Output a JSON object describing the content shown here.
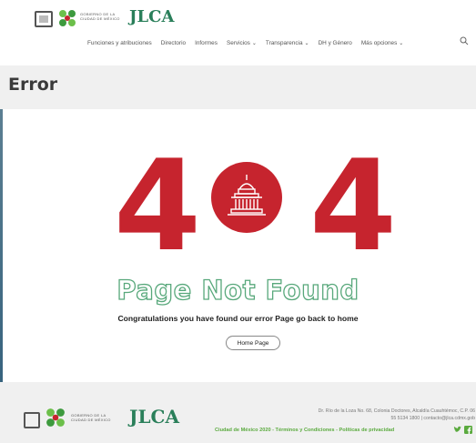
{
  "header": {
    "gov_logo_text": "GOBIERNO DE LA CIUDAD DE MÉXICO",
    "brand_logo_text": "JLCA",
    "nav": [
      {
        "label": "Funciones y atribuciones",
        "dropdown": false
      },
      {
        "label": "Directorio",
        "dropdown": false
      },
      {
        "label": "Informes",
        "dropdown": false
      },
      {
        "label": "Servicios",
        "dropdown": true
      },
      {
        "label": "Transparencia",
        "dropdown": true
      },
      {
        "label": "DH y Género",
        "dropdown": false
      },
      {
        "label": "Más opciones",
        "dropdown": true
      }
    ]
  },
  "page_title": "Error",
  "error": {
    "code_left": "4",
    "code_right": "4",
    "heading": "Page Not Found",
    "message": "Congratulations you have found our error Page go back to home",
    "button_label": "Home Page"
  },
  "footer": {
    "gov_logo_text": "GOBIERNO DE LA CIUDAD DE MÉXICO",
    "brand_logo_text": "JLCA",
    "address_line1": "Dr. Río de la Loza No. 68, Colonia Doctores, Alcaldía Cuauhtémoc, C.P. 06",
    "address_line2": "55 5134 1800 | contacto@jlca.cdmx.gob",
    "links_prefix": "Ciudad de México 2020 -",
    "link_terms": "Términos y Condiciones",
    "link_privacy": "Políticas de privacidad",
    "separator": "-"
  },
  "colors": {
    "accent_red": "#c6242e",
    "accent_green": "#58a87b",
    "footer_green": "#5aaa3e"
  }
}
